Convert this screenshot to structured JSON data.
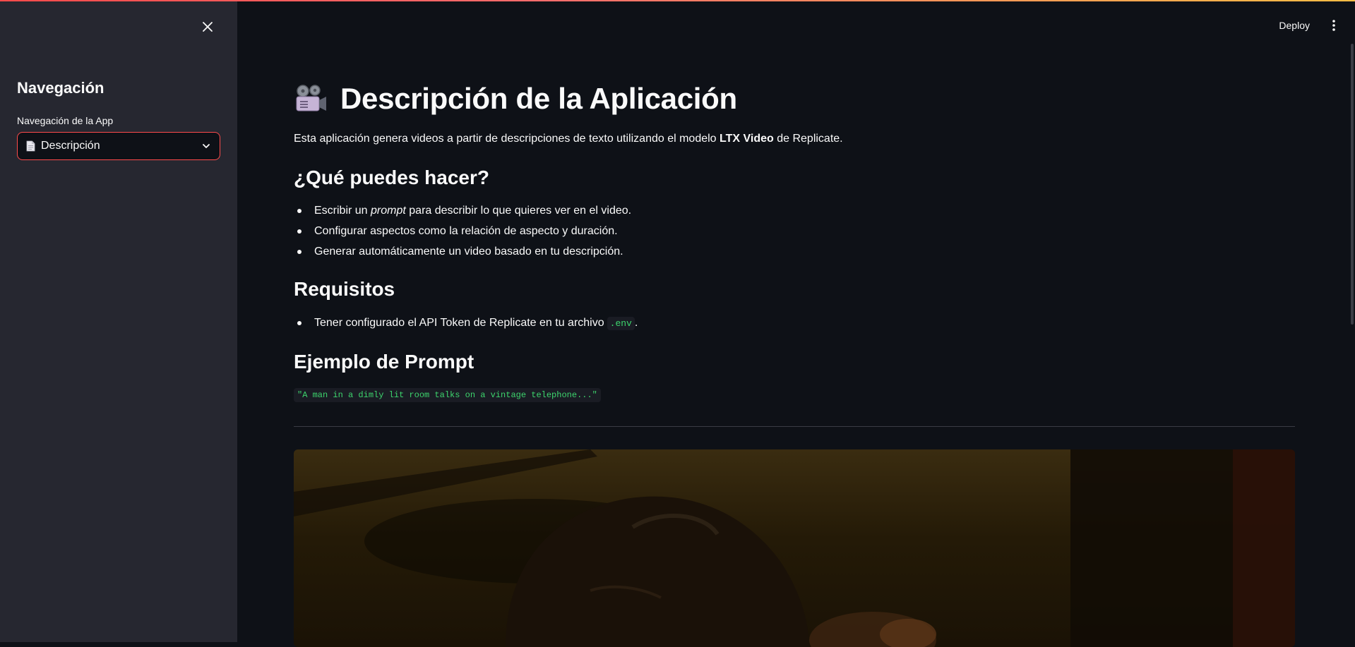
{
  "sidebar": {
    "title": "Navegación",
    "select_label": "Navegación de la App",
    "selected_value": "Descripción"
  },
  "header": {
    "deploy_label": "Deploy"
  },
  "main": {
    "title": "Descripción de la Aplicación",
    "intro": {
      "before": "Esta aplicación genera videos a partir de descripciones de texto utilizando el modelo ",
      "bold": "LTX Video",
      "after": " de Replicate."
    },
    "section1": {
      "heading": "¿Qué puedes hacer?",
      "item1": {
        "before": "Escribir un ",
        "em": "prompt",
        "after": " para describir lo que quieres ver en el video."
      },
      "item2": "Configurar aspectos como la relación de aspecto y duración.",
      "item3": "Generar automáticamente un video basado en tu descripción."
    },
    "section2": {
      "heading": "Requisitos",
      "item1_before": "Tener configurado el API Token de Replicate en tu archivo",
      "item1_code": ".env",
      "item1_after": "."
    },
    "section3": {
      "heading": "Ejemplo de Prompt",
      "code": "\"A man in a dimly lit room talks on a vintage telephone...\""
    }
  },
  "colors": {
    "accent": "#ff4b4b",
    "background": "#0e1117",
    "sidebar_bg": "#262730",
    "code_text": "#3dd56d"
  },
  "icons": {
    "close": "close-icon",
    "document": "document-icon",
    "chevron": "chevron-down-icon",
    "menu": "more-vertical-icon",
    "title": "movie-camera-icon"
  }
}
